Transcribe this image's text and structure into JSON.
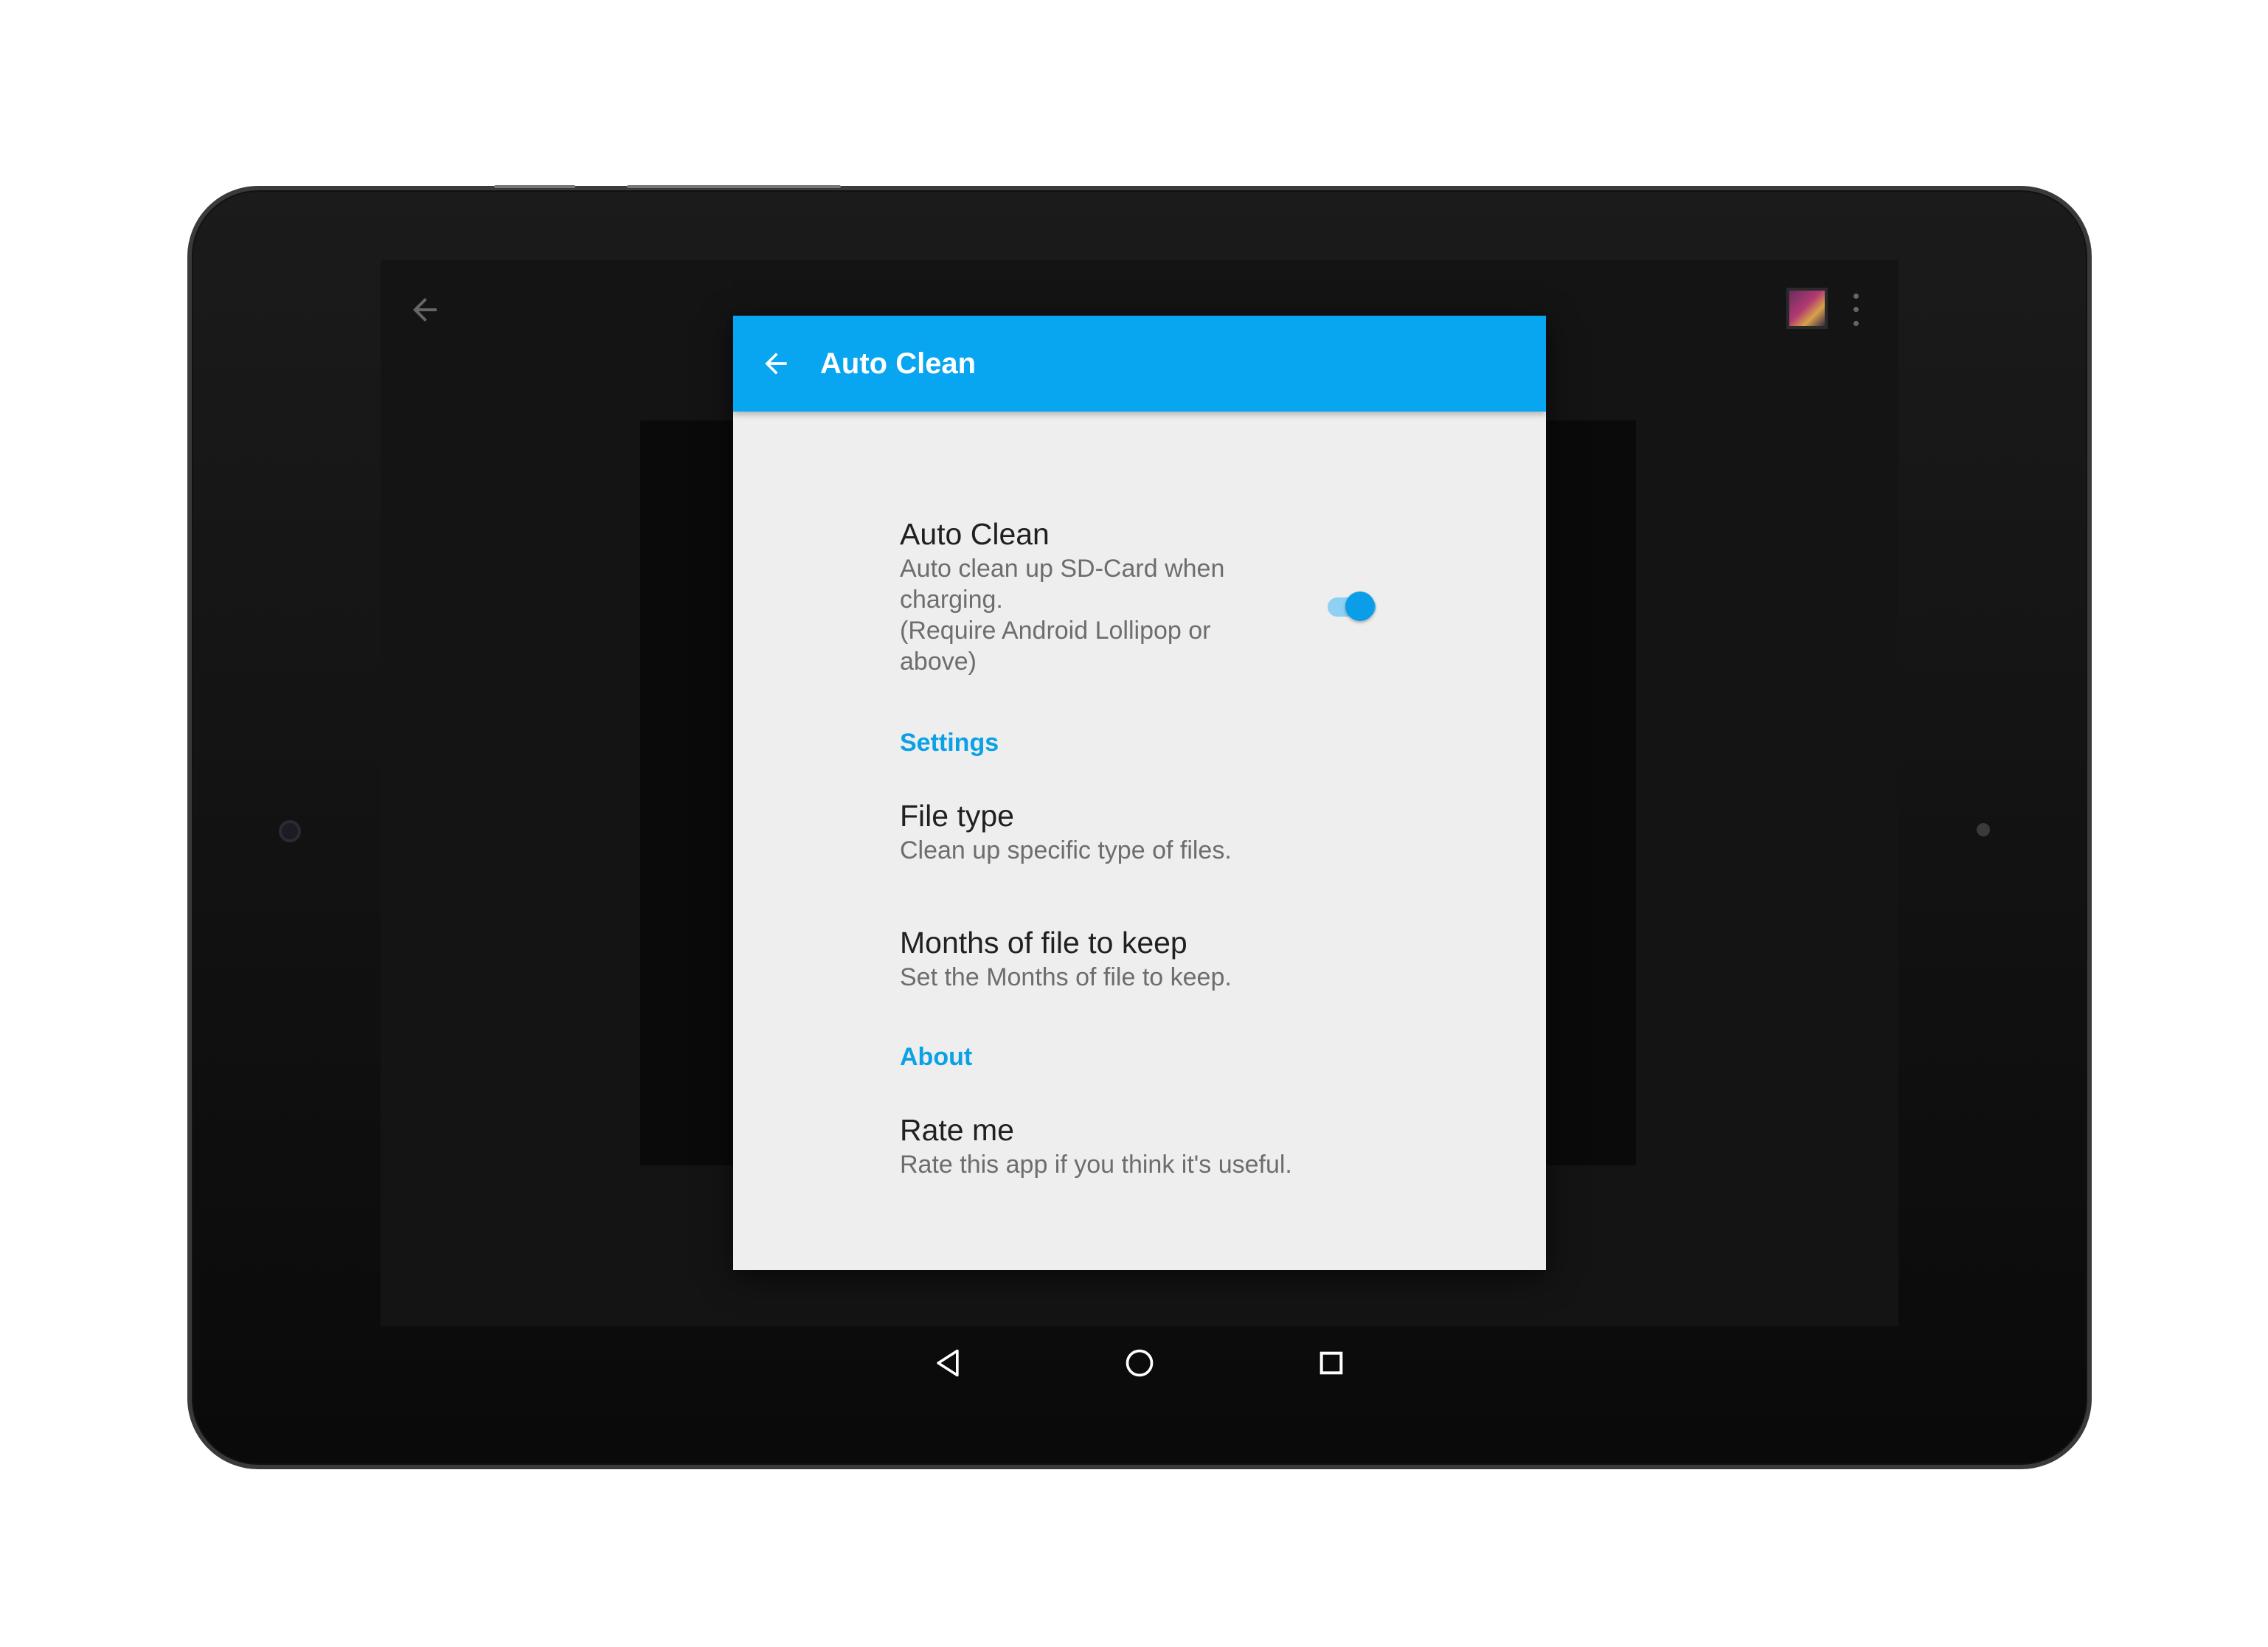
{
  "toolbar": {
    "title": "Auto Clean"
  },
  "auto_clean": {
    "title": "Auto Clean",
    "summary": "Auto clean up SD-Card when\ncharging.\n (Require Android Lollipop or\nabove)",
    "enabled": true
  },
  "categories": {
    "settings": "Settings",
    "about": "About"
  },
  "file_type": {
    "title": "File type",
    "summary": "Clean up specific type of files."
  },
  "months_keep": {
    "title": "Months of file to keep",
    "summary": "Set the Months of file to keep."
  },
  "rate_me": {
    "title": "Rate me",
    "summary": "Rate this app if you think it's useful."
  },
  "colors": {
    "accent": "#08a6f0",
    "dialog_bg": "#eeeeee",
    "switch_on": "#0a9ee8"
  },
  "icons": {
    "toolbar_back": "arrow-left-icon",
    "nav_back": "triangle-back-icon",
    "nav_home": "circle-home-icon",
    "nav_recents": "square-recents-icon"
  }
}
